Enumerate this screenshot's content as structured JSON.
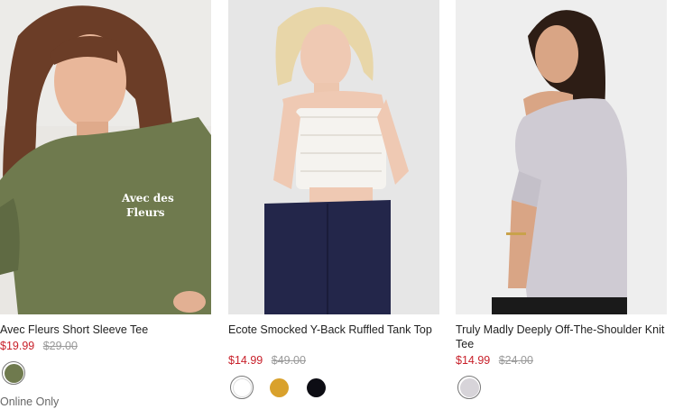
{
  "products": [
    {
      "name": "Avec Fleurs Short Sleeve Tee",
      "sale_price": "$19.99",
      "original_price": "$29.00",
      "image_text": "Avec des Fleurs",
      "swatches": [
        {
          "color": "#6f7a4e",
          "selected": true
        }
      ],
      "note": "Online Only"
    },
    {
      "name": "Ecote Smocked Y-Back Ruffled Tank Top",
      "sale_price": "$14.99",
      "original_price": "$49.00",
      "swatches": [
        {
          "color": "#ffffff",
          "selected": true
        },
        {
          "color": "#d9a12c",
          "selected": false
        },
        {
          "color": "#0d0d14",
          "selected": false
        }
      ]
    },
    {
      "name": "Truly Madly Deeply Off-The-Shoulder Knit Tee",
      "sale_price": "$14.99",
      "original_price": "$24.00",
      "swatches": [
        {
          "color": "#d7d4d9",
          "selected": true
        }
      ]
    }
  ],
  "colors": {
    "sale": "#c8202a",
    "original": "#9a9a9a",
    "text": "#222222"
  }
}
